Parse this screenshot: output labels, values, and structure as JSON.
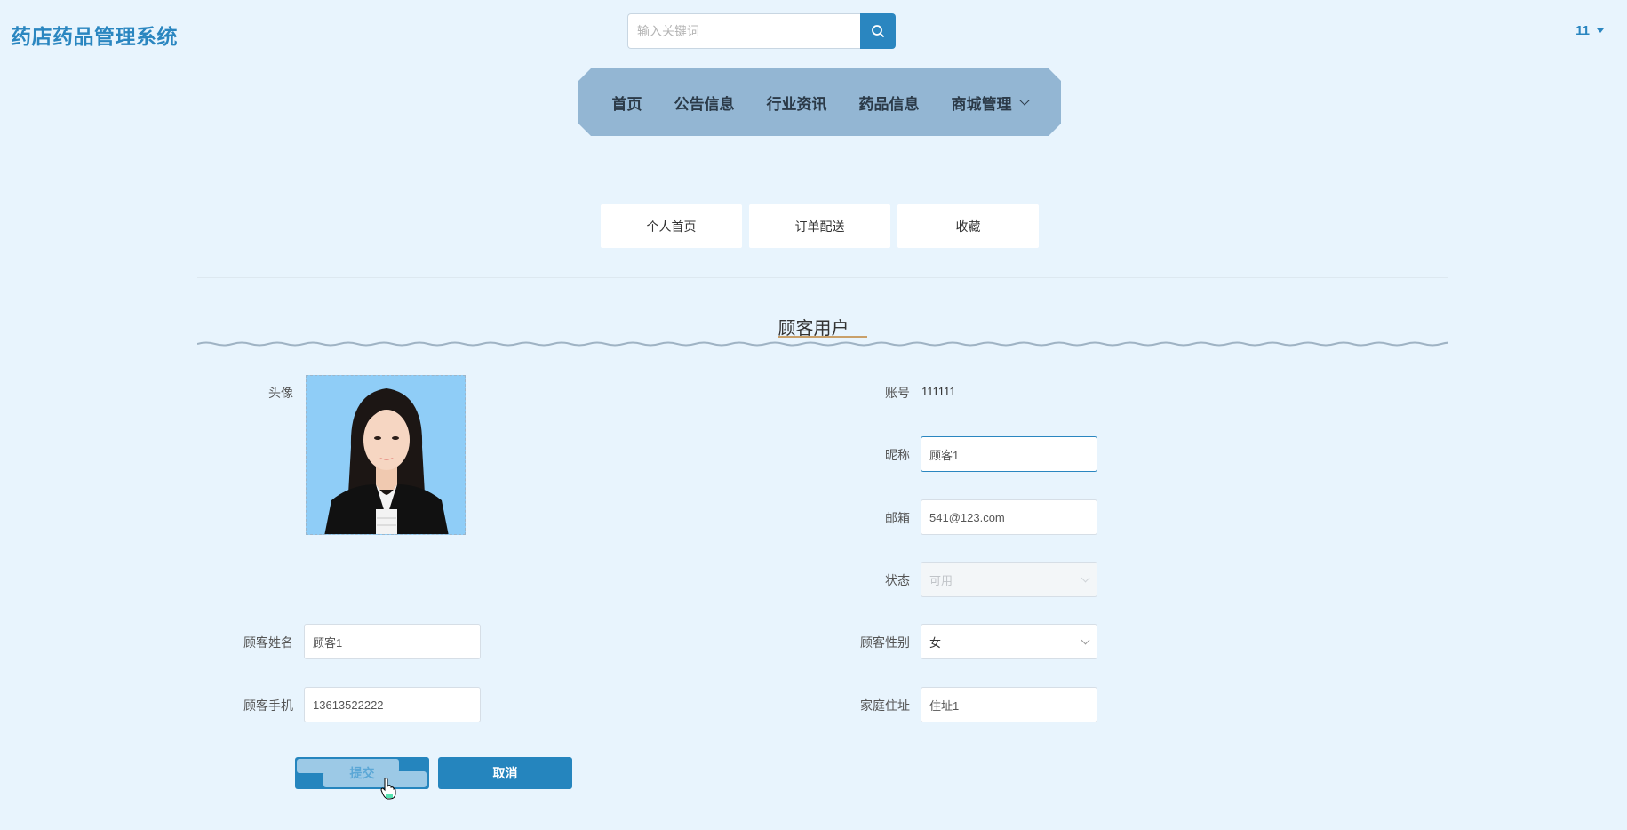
{
  "header": {
    "brand": "药店药品管理系统",
    "search_placeholder": "输入关键词",
    "user_label": "11"
  },
  "nav": {
    "items": [
      {
        "label": "首页"
      },
      {
        "label": "公告信息"
      },
      {
        "label": "行业资讯"
      },
      {
        "label": "药品信息"
      },
      {
        "label": "商城管理"
      }
    ]
  },
  "tabs": [
    {
      "label": "个人首页"
    },
    {
      "label": "订单配送"
    },
    {
      "label": "收藏"
    }
  ],
  "section": {
    "title": "顾客用户"
  },
  "form": {
    "avatar_label": "头像",
    "account_label": "账号",
    "account_value": "111111",
    "nickname_label": "昵称",
    "nickname_value": "顾客1",
    "email_label": "邮箱",
    "email_value": "541@123.com",
    "status_label": "状态",
    "status_value": "可用",
    "name_label": "顾客姓名",
    "name_value": "顾客1",
    "gender_label": "顾客性别",
    "gender_value": "女",
    "phone_label": "顾客手机",
    "phone_value": "13613522222",
    "address_label": "家庭住址",
    "address_value": "住址1",
    "submit_label": "提交",
    "cancel_label": "取消"
  },
  "colors": {
    "accent": "#2a86c0",
    "nav_bg": "#93b6d3",
    "page_bg": "#e8f4fd"
  }
}
